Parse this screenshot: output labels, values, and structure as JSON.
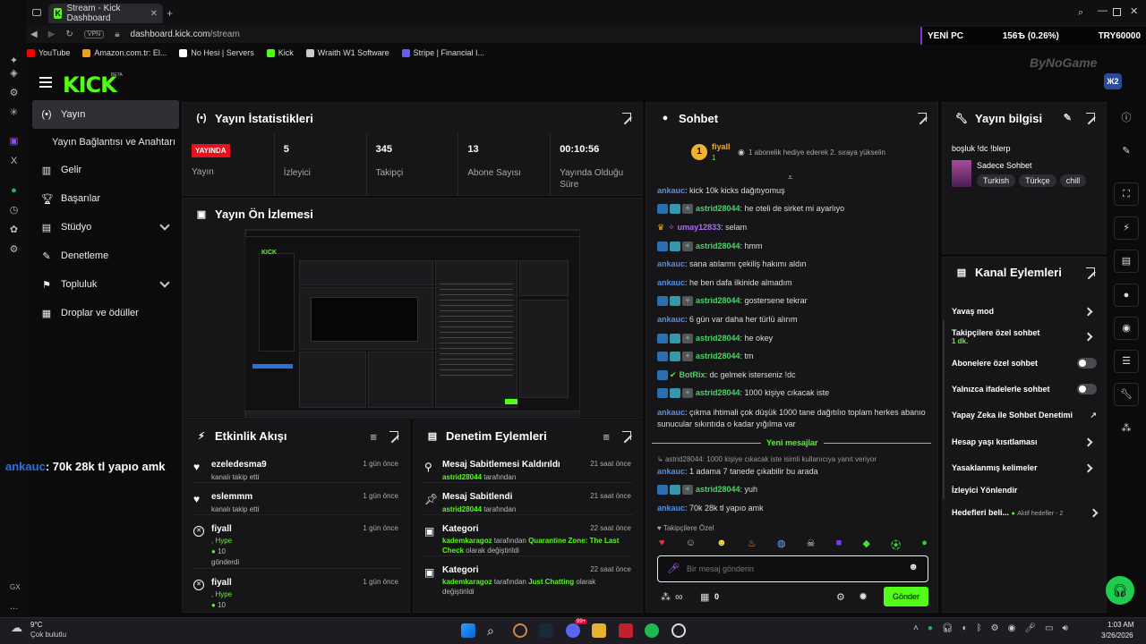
{
  "browser": {
    "tab_title": "Stream - Kick Dashboard",
    "url_domain": "dashboard.kick.com",
    "url_path": "/stream",
    "vpn_label": "VPN",
    "bookmarks": [
      {
        "label": "YouTube",
        "color": "#ff0000"
      },
      {
        "label": "Amazon.com.tr: El...",
        "color": "#f0a020"
      },
      {
        "label": "No Hesi | Servers",
        "color": "#ffffff"
      },
      {
        "label": "Kick",
        "color": "#53fc18"
      },
      {
        "label": "Wraith W1 Software",
        "color": "#cccccc"
      },
      {
        "label": "Stripe | Financial I...",
        "color": "#635bff"
      }
    ],
    "ticker": {
      "name": "YENİ PC",
      "value": "156Ѣ (0.26%)",
      "goal": "TRY60000"
    }
  },
  "brand": {
    "logo": "KICK",
    "beta": "BETA",
    "overlay_brand": "ByNoGame",
    "overlay_badge": "Ж2"
  },
  "nav": {
    "items": [
      {
        "label": "Yayın",
        "icon": "broadcast-icon"
      },
      {
        "label": "Yayın Bağlantısı ve Anahtarı"
      },
      {
        "label": "Gelir",
        "icon": "revenue-icon"
      },
      {
        "label": "Başarılar",
        "icon": "trophy-icon"
      },
      {
        "label": "Stüdyo",
        "icon": "studio-icon"
      },
      {
        "label": "Denetleme",
        "icon": "moderation-icon"
      },
      {
        "label": "Topluluk",
        "icon": "community-icon"
      },
      {
        "label": "Droplar ve ödüller",
        "icon": "drops-icon"
      }
    ]
  },
  "overlay_chat": {
    "user": "ankauc",
    "message": ": 70k 28k tl yapıo amk"
  },
  "stats": {
    "title": "Yayın İstatistikleri",
    "live_badge": "YAYINDA",
    "items": [
      {
        "value": "",
        "label": "Yayın"
      },
      {
        "value": "5",
        "label": "İzleyici"
      },
      {
        "value": "345",
        "label": "Takipçi"
      },
      {
        "value": "13",
        "label": "Abone Sayısı"
      },
      {
        "value": "00:10:56",
        "label": "Yayında Olduğu Süre"
      }
    ]
  },
  "preview": {
    "title": "Yayın Ön İzlemesi"
  },
  "activity": {
    "title": "Etkinlik Akışı",
    "rows": [
      {
        "name": "ezeledesma9",
        "sub": "kanalı takip etti",
        "time": "1 gün önce",
        "icon": "heart-icon"
      },
      {
        "name": "eslemmm",
        "sub": "kanalı takip etti",
        "time": "1 gün önce",
        "icon": "heart-icon"
      },
      {
        "name": "fiyall",
        "sub": ", Hype",
        "extra": "10",
        "extra2": "gönderdi",
        "time": "1 gün önce",
        "icon": "kick-x-icon"
      },
      {
        "name": "fiyall",
        "sub": ", Hype",
        "extra": "10",
        "time": "1 gün önce",
        "icon": "kick-x-icon"
      }
    ]
  },
  "moderation": {
    "title": "Denetim Eylemleri",
    "rows": [
      {
        "name": "Mesaj Sabitlemesi Kaldırıldı",
        "user": "astrid28044",
        "sub": " tarafından",
        "time": "21 saat önce",
        "icon": "unpin-icon"
      },
      {
        "name": "Mesaj Sabitlendi",
        "user": "astrid28044",
        "sub": " tarafından",
        "time": "21 saat önce",
        "icon": "pin-icon"
      },
      {
        "name": "Kategori",
        "user": "kademkaragoz",
        "sub": " tarafından ",
        "cat": "Quarantine Zone: The Last Check",
        "sub2": " olarak değiştirildi",
        "time": "22 saat önce",
        "icon": "category-icon"
      },
      {
        "name": "Kategori",
        "user": "kademkaragoz",
        "sub": " tarafından ",
        "cat": "Just Chatting",
        "sub2": " olarak değiştirildi",
        "time": "22 saat önce",
        "icon": "category-icon"
      }
    ]
  },
  "chat": {
    "title": "Sohbet",
    "pinned_user": "fiyall",
    "pinned_sub": "1",
    "pinned_msg": "1 abonelik hediye ederek 2. sıraya yükselin",
    "messages": [
      {
        "user": "ankauc",
        "type": "blue",
        "text": ": kick 10k kicks dağıtıyomuş"
      },
      {
        "user": "astrid28044",
        "type": "green",
        "badges": true,
        "text": ": he oteli de sirket mi ayarlıyo"
      },
      {
        "user": "umay12833",
        "type": "purple",
        "badges": false,
        "crown": true,
        "text": ": selam"
      },
      {
        "user": "astrid28044",
        "type": "green",
        "badges": true,
        "text": ": hmm"
      },
      {
        "user": "ankauc",
        "type": "blue",
        "text": ": sana atılarmı çekiliş hakımı aldın"
      },
      {
        "user": "ankauc",
        "type": "blue",
        "text": ": he ben dafa ilkinide almadım"
      },
      {
        "user": "astrid28044",
        "type": "green",
        "badges": true,
        "text": ": gostersene tekrar"
      },
      {
        "user": "ankauc",
        "type": "blue",
        "text": ": 6 gün var daha her türlü alırım"
      },
      {
        "user": "astrid28044",
        "type": "green",
        "badges": true,
        "text": ": he okey"
      },
      {
        "user": "astrid28044",
        "type": "green",
        "badges": true,
        "text": ": tm"
      },
      {
        "user": "BotRix",
        "type": "green",
        "bot": true,
        "text": ": dc gelmek isterseniz !dc"
      },
      {
        "user": "astrid28044",
        "type": "green",
        "badges": true,
        "text": ": 1000 kişiye cıkacak iste"
      }
    ],
    "long_msg_user": "ankauc",
    "long_msg": ": çıkma ihtimali çok düşük 1000 tane dağıtılıo toplam herkes abanıo sunucular sıkıntıda o kadar yığılma var",
    "new_messages": "Yeni mesajlar",
    "reply_hint": "astrid28044: 1000 kişiye cıkacak iste isimli kullanıcıya yanıt veriyor",
    "after": [
      {
        "user": "ankauc",
        "type": "blue",
        "text": ": 1 adama 7 tanede çıkabilir bu arada"
      },
      {
        "user": "astrid28044",
        "type": "green",
        "badges": true,
        "text": ": yuh"
      },
      {
        "user": "ankauc",
        "type": "blue",
        "text": ": 70k 28k tl yapıo amk"
      }
    ],
    "followers_only": "Takipçilere Özel",
    "placeholder": "Bir mesaj gönderin",
    "kicks_count": "0",
    "send": "Gönder",
    "infinity": "∞"
  },
  "stream_info": {
    "title": "Yayın bilgisi",
    "stream_title": "boşluk !dc !blerp",
    "category": "Sadece Sohbet",
    "tags": [
      "Turkish",
      "Türkçe",
      "chill"
    ]
  },
  "channel_actions": {
    "title": "Kanal Eylemleri",
    "items": [
      {
        "label": "Yavaş mod",
        "ctrl": "chevron"
      },
      {
        "label": "Takipçilere özel sohbet",
        "sub": "1 dk.",
        "ctrl": "chevron"
      },
      {
        "label": "Abonelere özel sohbet",
        "ctrl": "toggle"
      },
      {
        "label": "Yalnızca ifadelerle sohbet",
        "ctrl": "toggle"
      },
      {
        "label": "Yapay Zeka ile Sohbet Denetimi",
        "ctrl": "external"
      },
      {
        "label": "Hesap yaşı kısıtlaması",
        "ctrl": "chevron"
      },
      {
        "label": "Yasaklanmış kelimeler",
        "ctrl": "chevron"
      },
      {
        "label": "İzleyici Yönlendir",
        "ctrl": "none"
      },
      {
        "label": "Hedefleri beli...",
        "sub": "Aktif hedefler - 2",
        "ctrl": "chevron"
      }
    ]
  },
  "taskbar": {
    "temp": "9°C",
    "weather": "Çok bulutlu",
    "time": "1:03 AM",
    "date": "3/26/2026",
    "discord_badge": "99+"
  },
  "opera_gx": {
    "label": "GX",
    "more": "..."
  }
}
